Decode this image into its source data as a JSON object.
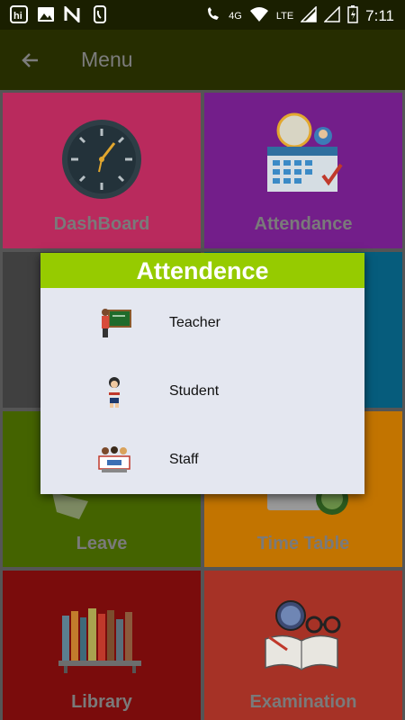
{
  "status_bar": {
    "time": "7:11",
    "network": "4G",
    "lte": "LTE",
    "left_icons": [
      "hike-icon",
      "image-icon",
      "n-app-icon",
      "phone-icon"
    ]
  },
  "app_bar": {
    "title": "Menu"
  },
  "tiles": [
    {
      "label": "DashBoard",
      "color": "#b92a5d"
    },
    {
      "label": "Attendance",
      "color": "#731e8a"
    },
    {
      "label": "",
      "color": "#404040"
    },
    {
      "label": "",
      "color": "#065c7c"
    },
    {
      "label": "Leave",
      "color": "#446300"
    },
    {
      "label": "Time Table",
      "color": "#c27400"
    },
    {
      "label": "Library",
      "color": "#7a0c0c"
    },
    {
      "label": "Examination",
      "color": "#a63226"
    }
  ],
  "dialog": {
    "title": "Attendence",
    "accent": "#96cb00",
    "options": [
      {
        "label": "Teacher",
        "icon": "teacher-icon"
      },
      {
        "label": "Student",
        "icon": "student-icon"
      },
      {
        "label": "Staff",
        "icon": "staff-icon"
      }
    ]
  }
}
